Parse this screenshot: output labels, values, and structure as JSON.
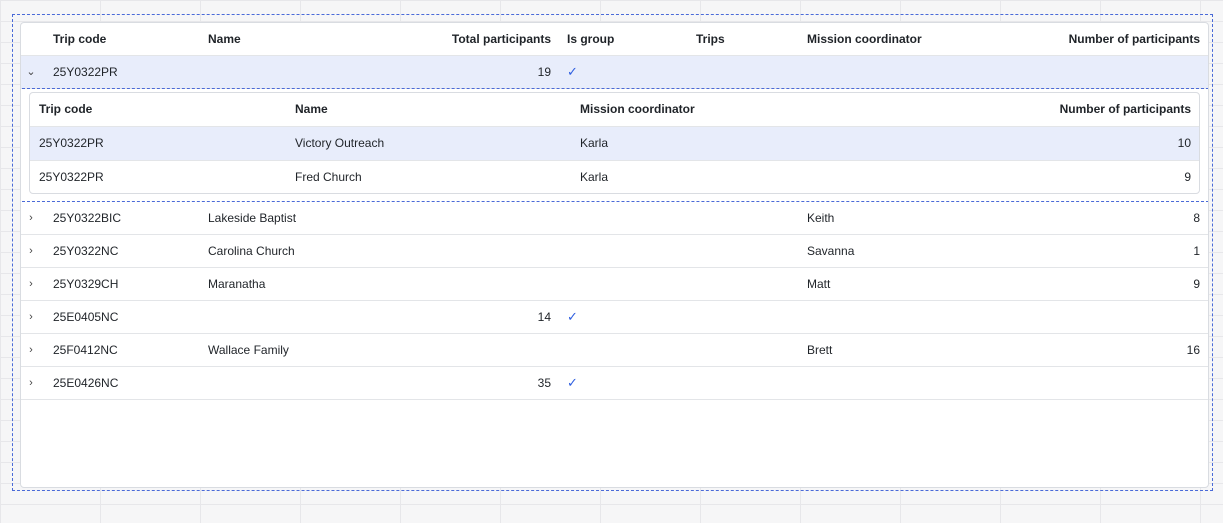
{
  "columns": {
    "trip_code": "Trip code",
    "name": "Name",
    "total_participants": "Total participants",
    "is_group": "Is group",
    "trips": "Trips",
    "mission_coordinator": "Mission coordinator",
    "number_of_participants": "Number of participants"
  },
  "expanded_row": {
    "trip_code": "25Y0322PR",
    "total_participants": "19",
    "is_group": "✓"
  },
  "sub_table": {
    "columns": {
      "trip_code": "Trip code",
      "name": "Name",
      "mission_coordinator": "Mission coordinator",
      "number_of_participants": "Number of participants"
    },
    "rows": [
      {
        "trip_code": "25Y0322PR",
        "name": "Victory Outreach",
        "mission_coordinator": "Karla",
        "number_of_participants": "10"
      },
      {
        "trip_code": "25Y0322PR",
        "name": "Fred Church",
        "mission_coordinator": "Karla",
        "number_of_participants": "9"
      }
    ]
  },
  "rows": [
    {
      "trip_code": "25Y0322BIC",
      "name": "Lakeside Baptist",
      "total_participants": "",
      "is_group": "",
      "mission_coordinator": "Keith",
      "number_of_participants": "8"
    },
    {
      "trip_code": "25Y0322NC",
      "name": "Carolina Church",
      "total_participants": "",
      "is_group": "",
      "mission_coordinator": "Savanna",
      "number_of_participants": "1"
    },
    {
      "trip_code": "25Y0329CH",
      "name": "Maranatha",
      "total_participants": "",
      "is_group": "",
      "mission_coordinator": "Matt",
      "number_of_participants": "9"
    },
    {
      "trip_code": "25E0405NC",
      "name": "",
      "total_participants": "14",
      "is_group": "✓",
      "mission_coordinator": "",
      "number_of_participants": ""
    },
    {
      "trip_code": "25F0412NC",
      "name": "Wallace Family",
      "total_participants": "",
      "is_group": "",
      "mission_coordinator": "Brett",
      "number_of_participants": "16"
    },
    {
      "trip_code": "25E0426NC",
      "name": "",
      "total_participants": "35",
      "is_group": "✓",
      "mission_coordinator": "",
      "number_of_participants": ""
    }
  ],
  "icons": {
    "expand": "chevron-right-icon",
    "collapse": "chevron-down-icon",
    "check": "check-icon"
  },
  "colors": {
    "accent": "#2f5fe0",
    "selection": "#e8edfb",
    "frame": "#4a6ad8"
  }
}
